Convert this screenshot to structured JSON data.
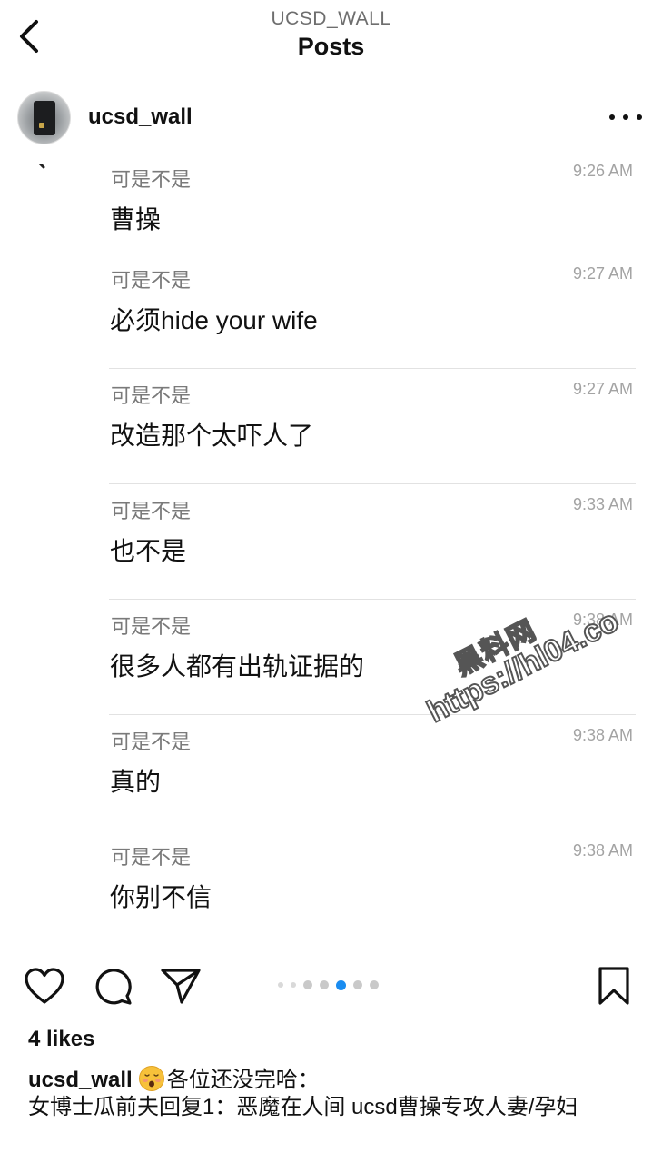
{
  "header": {
    "account": "UCSD_WALL",
    "title": "Posts"
  },
  "post": {
    "username": "ucsd_wall"
  },
  "messages": [
    {
      "sender": "可是不是",
      "time": "9:26 AM",
      "text": "曹操"
    },
    {
      "sender": "可是不是",
      "time": "9:27 AM",
      "text": "必须hide your wife"
    },
    {
      "sender": "可是不是",
      "time": "9:27 AM",
      "text": "改造那个太吓人了"
    },
    {
      "sender": "可是不是",
      "time": "9:33 AM",
      "text": "也不是"
    },
    {
      "sender": "可是不是",
      "time": "9:38 AM",
      "text": "很多人都有出轨证据的"
    },
    {
      "sender": "可是不是",
      "time": "9:38 AM",
      "text": "真的"
    },
    {
      "sender": "可是不是",
      "time": "9:38 AM",
      "text": "你别不信"
    }
  ],
  "watermark": {
    "line1": "黑料网",
    "line2": "https://hl04.co"
  },
  "carousel": {
    "count": 7,
    "active_index": 4
  },
  "likes": "4 likes",
  "caption": {
    "username": "ucsd_wall",
    "emoji": "face-with-open-mouth-icon",
    "text": "各位还没完哈：\n女博士瓜前夫回复1：恶魔在人间 ucsd曹操专攻人妻/孕妇"
  },
  "colors": {
    "active_dot": "#1a8cf0",
    "inactive_dot": "#c9c9c9",
    "divider": "#e2e2e2"
  }
}
